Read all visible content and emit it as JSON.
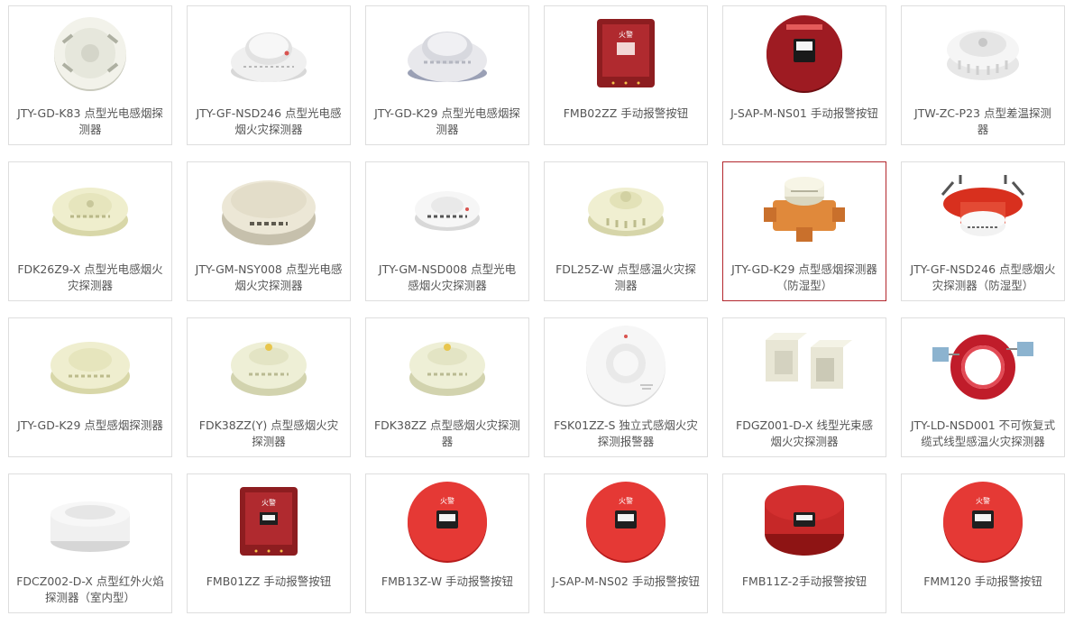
{
  "products": [
    {
      "name": "JTY-GD-K83 点型光电感烟探测器",
      "icon": "smoke-detector"
    },
    {
      "name": "JTY-GF-NSD246 点型光电感烟火灾探测器",
      "icon": "smoke-detector"
    },
    {
      "name": "JTY-GD-K29 点型光电感烟探测器",
      "icon": "smoke-detector"
    },
    {
      "name": "FMB02ZZ 手动报警按钮",
      "icon": "manual-call-point"
    },
    {
      "name": "J-SAP-M-NS01 手动报警按钮",
      "icon": "manual-call-point"
    },
    {
      "name": "JTW-ZC-P23 点型差温探测器",
      "icon": "heat-detector"
    },
    {
      "name": "FDK26Z9-X 点型光电感烟火灾探测器",
      "icon": "smoke-detector"
    },
    {
      "name": "JTY-GM-NSY008 点型光电感烟火灾探测器",
      "icon": "smoke-detector"
    },
    {
      "name": "JTY-GM-NSD008 点型光电感烟火灾探测器",
      "icon": "smoke-detector"
    },
    {
      "name": "FDL25Z-W 点型感温火灾探测器",
      "icon": "heat-detector"
    },
    {
      "name": "JTY-GD-K29 点型感烟探测器（防湿型）",
      "icon": "smoke-detector"
    },
    {
      "name": "JTY-GF-NSD246 点型感烟火灾探测器（防湿型）",
      "icon": "smoke-detector"
    },
    {
      "name": "JTY-GD-K29 点型感烟探测器",
      "icon": "smoke-detector"
    },
    {
      "name": "FDK38ZZ(Y) 点型感烟火灾探测器",
      "icon": "smoke-detector"
    },
    {
      "name": "FDK38ZZ 点型感烟火灾探测器",
      "icon": "smoke-detector"
    },
    {
      "name": "FSK01ZZ-S 独立式感烟火灾探测报警器",
      "icon": "smoke-detector"
    },
    {
      "name": "FDGZ001-D-X 线型光束感烟火灾探测器",
      "icon": "beam-detector"
    },
    {
      "name": "JTY-LD-NSD001 不可恢复式缆式线型感温火灾探测器",
      "icon": "cable-detector"
    },
    {
      "name": "FDCZ002-D-X 点型红外火焰探测器（室内型）",
      "icon": "flame-detector"
    },
    {
      "name": "FMB01ZZ 手动报警按钮",
      "icon": "manual-call-point"
    },
    {
      "name": "FMB13Z-W 手动报警按钮",
      "icon": "manual-call-point"
    },
    {
      "name": "J-SAP-M-NS02 手动报警按钮",
      "icon": "manual-call-point"
    },
    {
      "name": "FMB11Z-2手动报警按钮",
      "icon": "manual-call-point"
    },
    {
      "name": "FMM120 手动报警按钮",
      "icon": "manual-call-point"
    }
  ],
  "active_index": 10
}
